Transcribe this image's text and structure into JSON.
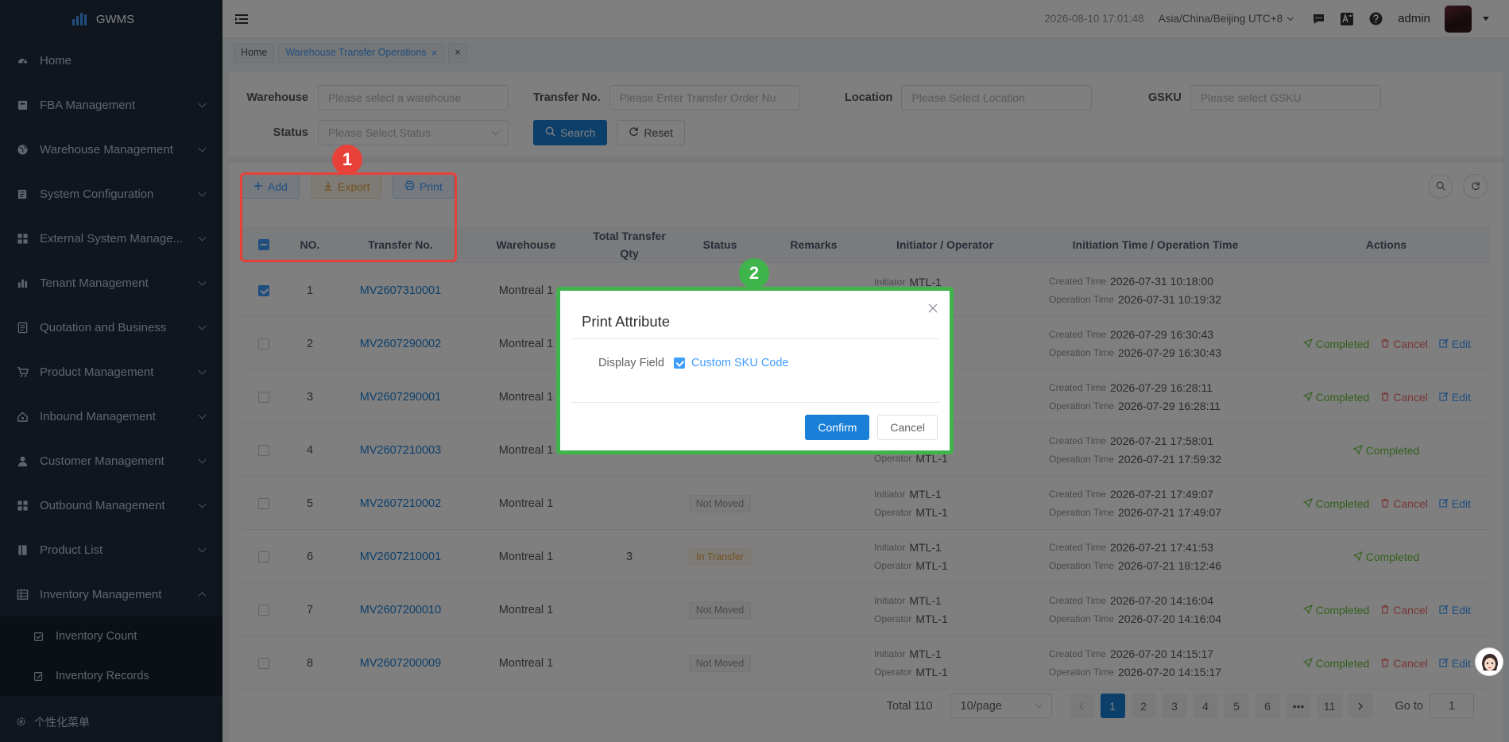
{
  "app": {
    "title": "GWMS"
  },
  "sidebar": {
    "items": [
      {
        "label": "Home",
        "icon": "dashboard-icon",
        "expandable": false
      },
      {
        "label": "FBA Management",
        "icon": "box-icon",
        "expandable": true
      },
      {
        "label": "Warehouse Management",
        "icon": "globe-icon",
        "expandable": true
      },
      {
        "label": "System Configuration",
        "icon": "config-icon",
        "expandable": true
      },
      {
        "label": "External System Manage...",
        "icon": "grid-icon",
        "expandable": true
      },
      {
        "label": "Tenant Management",
        "icon": "bar-chart-icon",
        "expandable": true
      },
      {
        "label": "Quotation and Business",
        "icon": "document-icon",
        "expandable": true
      },
      {
        "label": "Product Management",
        "icon": "cart-icon",
        "expandable": true
      },
      {
        "label": "Inbound Management",
        "icon": "house-icon",
        "expandable": true
      },
      {
        "label": "Customer Management",
        "icon": "user-icon",
        "expandable": true
      },
      {
        "label": "Outbound Management",
        "icon": "grid-icon",
        "expandable": true
      },
      {
        "label": "Product List",
        "icon": "book-icon",
        "expandable": true
      },
      {
        "label": "Inventory Management",
        "icon": "table-icon",
        "expandable": true,
        "open": true
      }
    ],
    "subitems": [
      {
        "label": "Inventory Count",
        "icon": "checkbox-icon"
      },
      {
        "label": "Inventory Records",
        "icon": "edit-icon"
      }
    ],
    "bottom": "个性化菜单"
  },
  "header": {
    "datetime": "2026-08-10 17:01:48",
    "timezone": "Asia/China/Beijing UTC+8",
    "user": "admin"
  },
  "tags": {
    "home": "Home",
    "active": "Warehouse Transfer Operations",
    "close_symbol": "×"
  },
  "filters": {
    "warehouse_label": "Warehouse",
    "warehouse_placeholder": "Please select a warehouse",
    "transfer_label": "Transfer No.",
    "transfer_placeholder": "Please Enter Transfer Order Nu",
    "location_label": "Location",
    "location_placeholder": "Please Select Location",
    "gsku_label": "GSKU",
    "gsku_placeholder": "Please select GSKU",
    "status_label": "Status",
    "status_placeholder": "Please Select Status",
    "search": "Search",
    "reset": "Reset"
  },
  "toolbar": {
    "add": "Add",
    "export": "Export",
    "print": "Print"
  },
  "table": {
    "headers": {
      "no": "NO.",
      "transfer_no": "Transfer No.",
      "warehouse": "Warehouse",
      "qty_line1": "Total Transfer",
      "qty_line2": "Qty",
      "status": "Status",
      "remarks": "Remarks",
      "initiator": "Initiator / Operator",
      "time": "Initiation Time / Operation Time",
      "actions": "Actions"
    },
    "labels": {
      "initiator": "Initiator",
      "operator": "Operator",
      "created": "Created Time",
      "operation": "Operation Time",
      "completed": "Completed",
      "cancel": "Cancel",
      "edit": "Edit"
    },
    "rows": [
      {
        "no": "1",
        "transfer_no": "MV2607310001",
        "warehouse": "Montreal 1",
        "qty": "",
        "status": "",
        "initiator": "MTL-1",
        "operator": "",
        "created": "2026-07-31 10:18:00",
        "operation": "2026-07-31 10:19:32",
        "checked": true,
        "actions": []
      },
      {
        "no": "2",
        "transfer_no": "MV2607290002",
        "warehouse": "Montreal 1",
        "qty": "",
        "status": "",
        "initiator": "",
        "operator": "",
        "created": "2026-07-29 16:30:43",
        "operation": "2026-07-29 16:30:43",
        "checked": false,
        "actions": [
          "completed",
          "cancel",
          "edit"
        ]
      },
      {
        "no": "3",
        "transfer_no": "MV2607290001",
        "warehouse": "Montreal 1",
        "qty": "",
        "status": "",
        "initiator": "",
        "operator": "",
        "created": "2026-07-29 16:28:11",
        "operation": "2026-07-29 16:28:11",
        "checked": false,
        "actions": [
          "completed",
          "cancel",
          "edit"
        ]
      },
      {
        "no": "4",
        "transfer_no": "MV2607210003",
        "warehouse": "Montreal 1",
        "qty": "",
        "status": "",
        "initiator": "",
        "operator": "MTL-1",
        "created": "2026-07-21 17:58:01",
        "operation": "2026-07-21 17:59:32",
        "checked": false,
        "actions": [
          "completed"
        ]
      },
      {
        "no": "5",
        "transfer_no": "MV2607210002",
        "warehouse": "Montreal 1",
        "qty": "",
        "status": "Not Moved",
        "initiator": "MTL-1",
        "operator": "MTL-1",
        "created": "2026-07-21 17:49:07",
        "operation": "2026-07-21 17:49:07",
        "checked": false,
        "actions": [
          "completed",
          "cancel",
          "edit"
        ]
      },
      {
        "no": "6",
        "transfer_no": "MV2607210001",
        "warehouse": "Montreal 1",
        "qty": "3",
        "status": "In Transfer",
        "initiator": "MTL-1",
        "operator": "MTL-1",
        "created": "2026-07-21 17:41:53",
        "operation": "2026-07-21 18:12:46",
        "checked": false,
        "actions": [
          "completed"
        ]
      },
      {
        "no": "7",
        "transfer_no": "MV2607200010",
        "warehouse": "Montreal 1",
        "qty": "",
        "status": "Not Moved",
        "initiator": "MTL-1",
        "operator": "MTL-1",
        "created": "2026-07-20 14:16:04",
        "operation": "2026-07-20 14:16:04",
        "checked": false,
        "actions": [
          "completed",
          "cancel",
          "edit"
        ]
      },
      {
        "no": "8",
        "transfer_no": "MV2607200009",
        "warehouse": "Montreal 1",
        "qty": "",
        "status": "Not Moved",
        "initiator": "MTL-1",
        "operator": "MTL-1",
        "created": "2026-07-20 14:15:17",
        "operation": "2026-07-20 14:15:17",
        "checked": false,
        "actions": [
          "completed",
          "cancel",
          "edit"
        ]
      }
    ]
  },
  "pagination": {
    "total": "Total 110",
    "page_size": "10/page",
    "pages": [
      "1",
      "2",
      "3",
      "4",
      "5",
      "6",
      "•••",
      "11"
    ],
    "current": "1",
    "goto_label": "Go to",
    "goto_value": "1"
  },
  "modal": {
    "title": "Print Attribute",
    "field_label": "Display Field",
    "checkbox_label": "Custom SKU Code",
    "checkbox_checked": true,
    "confirm": "Confirm",
    "cancel": "Cancel"
  },
  "annotations": {
    "badge1": "1",
    "badge2": "2"
  },
  "colors": {
    "primary": "#1a7fd6",
    "success": "#67c23a",
    "danger": "#f56c6c",
    "warning": "#e6a23c",
    "highlight_red": "#e8413a",
    "highlight_green": "#3eb44b",
    "sidebar_bg": "#1f2d3d"
  }
}
